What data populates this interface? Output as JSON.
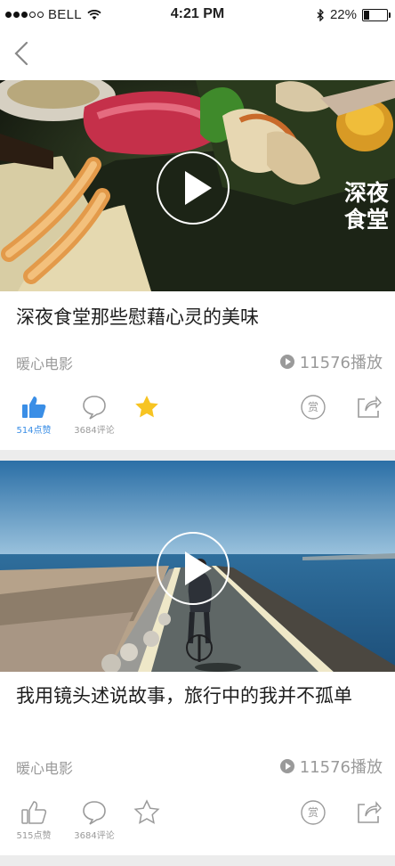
{
  "status_bar": {
    "carrier": "BELL",
    "time": "4:21 PM",
    "battery": "22%",
    "battery_level": 0.22,
    "signal_bars_filled": 3,
    "signal_bars_total": 5
  },
  "feed": [
    {
      "title": "深夜食堂那些慰藉心灵的美味",
      "image_text": "深夜食堂",
      "source": "暖心电影",
      "plays": "11576播放",
      "likes": "514点赞",
      "liked": true,
      "comments": "3684评论",
      "favorited": true,
      "reward_label": "赏"
    },
    {
      "title": "我用镜头述说故事，旅行中的我并不孤单",
      "source": "暖心电影",
      "plays": "11576播放",
      "likes": "515点赞",
      "liked": false,
      "comments": "3684评论",
      "favorited": false,
      "reward_label": "赏"
    }
  ],
  "colors": {
    "accent_blue": "#3a8ee6",
    "star_yellow": "#f7c422",
    "muted_gray": "#9a9a9a"
  }
}
